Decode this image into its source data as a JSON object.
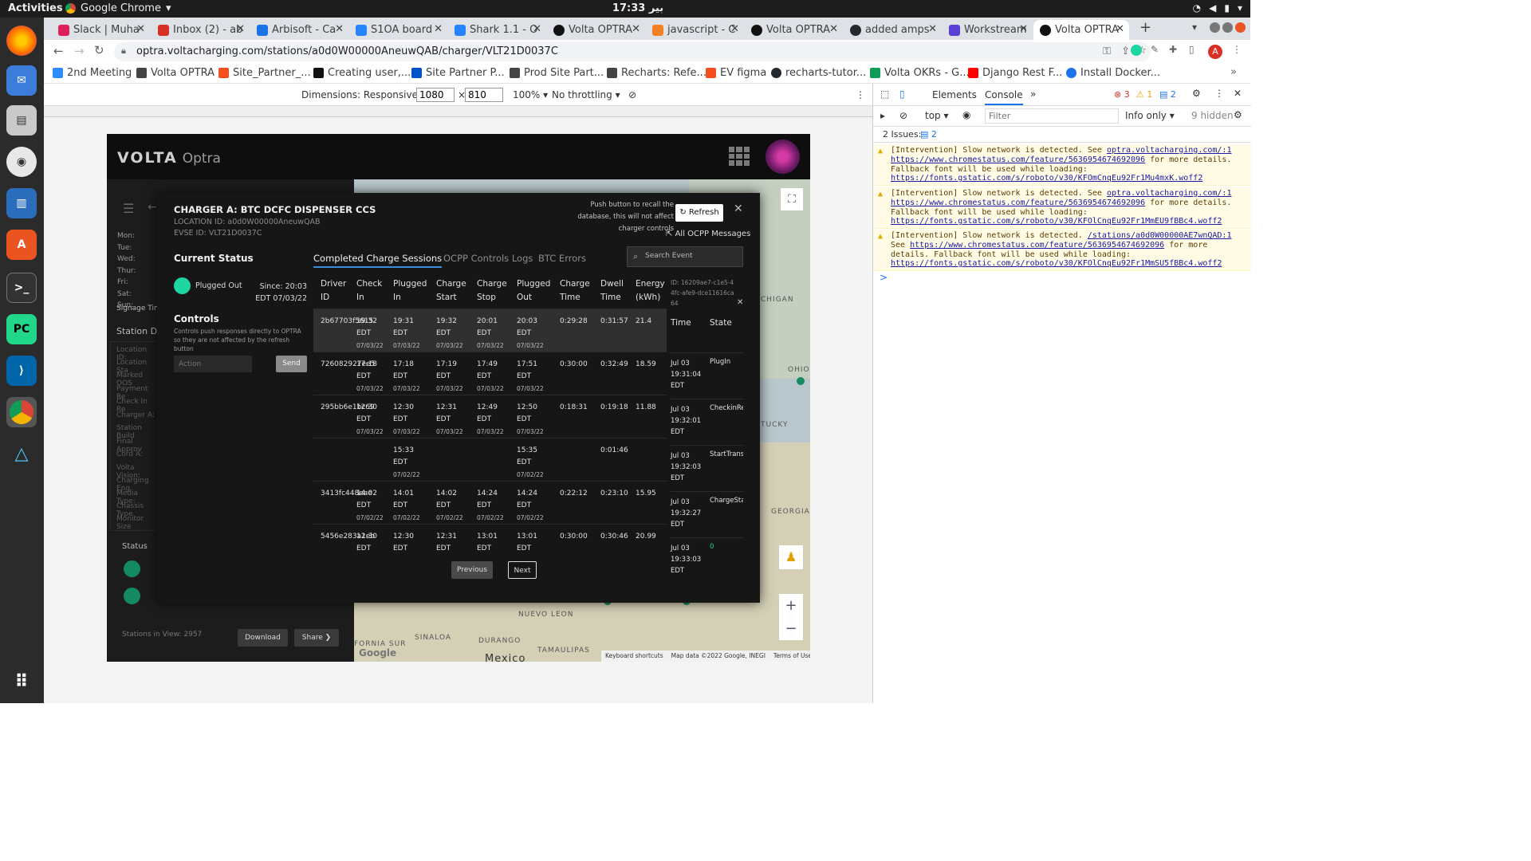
{
  "os": {
    "activities": "Activities",
    "app_name": "Google Chrome",
    "clock": "17:33 بير"
  },
  "tabs": [
    {
      "label": "Slack | Muha",
      "color": "#e01e5a"
    },
    {
      "label": "Inbox (2) - ab",
      "color": "#d93025"
    },
    {
      "label": "Arbisoft - Ca",
      "color": "#1a73e8"
    },
    {
      "label": "S1OA board",
      "color": "#2684ff"
    },
    {
      "label": "Shark 1.1 - O",
      "color": "#2684ff"
    },
    {
      "label": "Volta OPTRA",
      "color": "#111111"
    },
    {
      "label": "javascript - C",
      "color": "#f48024"
    },
    {
      "label": "Volta OPTRA",
      "color": "#111111"
    },
    {
      "label": "added amps",
      "color": "#24292e"
    },
    {
      "label": "Workstream",
      "color": "#5a3fd6"
    },
    {
      "label": "Volta OPTRA",
      "color": "#111111"
    }
  ],
  "url": "optra.voltacharging.com/stations/a0d0W00000AneuwQAB/charger/VLT21D0037C",
  "bookmarks": [
    {
      "label": "2nd Meeting",
      "color": "#2d8cff"
    },
    {
      "label": "Volta OPTRA",
      "color": "#444444"
    },
    {
      "label": "Site_Partner_...",
      "color": "#f24e1e"
    },
    {
      "label": "Creating user,...",
      "color": "#111111"
    },
    {
      "label": "Site Partner P...",
      "color": "#0052cc"
    },
    {
      "label": "Prod Site Part...",
      "color": "#444444"
    },
    {
      "label": "Recharts: Refe...",
      "color": "#444444"
    },
    {
      "label": "EV figma",
      "color": "#f24e1e"
    },
    {
      "label": "recharts-tutor...",
      "color": "#24292e"
    },
    {
      "label": "Volta OKRs - G...",
      "color": "#0f9d58"
    },
    {
      "label": "Django Rest F...",
      "color": "#ff0000"
    },
    {
      "label": "Install Docker...",
      "color": "#1a73e8"
    }
  ],
  "device_toolbar": {
    "dimensions": "Dimensions: Responsive",
    "width": "1080",
    "height": "810",
    "zoom": "100%",
    "throttling": "No throttling"
  },
  "app": {
    "logo": "VOLTA",
    "logo_sub": "Optra",
    "side_days": [
      "Mon:",
      "Tue:",
      "Wed:",
      "Thur:",
      "Fri:",
      "Sat:",
      "Sun:"
    ],
    "side_signage": "Signage Tim",
    "side_station": "Station Det",
    "side_fields": [
      "Location ID:",
      "Location Sta",
      "Marked OOS",
      "Payment Re",
      "Check In Re",
      "Charger A:",
      "Station Build",
      "Final Approv",
      "Cord A:",
      "Volta Vision:",
      "Charging Eng",
      "Media Type:",
      "Chassis Type",
      "Monitor Size"
    ],
    "side_status": "Status",
    "stations_in_view": "Stations in View: 2957",
    "download": "Download",
    "share": "Share",
    "map_labels": [
      "CHIGAN",
      "OHIO",
      "TUCKY",
      "GEORGIA",
      "NUEVO LEON",
      "SINALOA",
      "DURANGO",
      "TAMAULIPAS",
      "FORNIA SUR",
      "Mexico"
    ],
    "map_footer": [
      "Keyboard shortcuts",
      "Map data ©2022 Google, INEGI",
      "Terms of Use"
    ],
    "google": "Google"
  },
  "modal": {
    "title": "CHARGER A: BTC DCFC DISPENSER CCS",
    "location_id": "LOCATION ID: a0d0W00000AneuwQAB",
    "evse_id": "EVSE ID: VLT21D0037C",
    "hint": "Push button to recall the database, this will not affect charger controls",
    "refresh": "Refresh",
    "all_ocpp": "All OCPP Messages",
    "current_status": "Current Status",
    "status": "Plugged Out",
    "since": "Since: 20:03  EDT 07/03/22",
    "controls": "Controls",
    "controls_sub": "Controls push responses directly to OPTRA so they are not affected by the refresh button",
    "action_placeholder": "Action",
    "send": "Send",
    "tabs": [
      "Completed Charge Sessions",
      "OCPP Controls Logs",
      "BTC Errors"
    ],
    "search_placeholder": "Search Event",
    "previous": "Previous",
    "next": "Next",
    "columns": [
      "Driver ID",
      "Check In",
      "Plugged In",
      "Charge Start",
      "Charge Stop",
      "Plugged Out",
      "Charge Time",
      "Dwell Time",
      "Energy (kWh)"
    ],
    "sessions": [
      {
        "driver": "2b67703f5615",
        "check_in": "19:32",
        "check_in_d": "07/03/22",
        "plug_in": "19:31",
        "plug_in_d": "07/03/22",
        "start": "19:32",
        "start_d": "07/03/22",
        "stop": "20:01",
        "stop_d": "07/03/22",
        "plug_out": "20:03",
        "plug_out_d": "07/03/22",
        "charge_time": "0:29:28",
        "dwell": "0:31:57",
        "energy": "21.4"
      },
      {
        "driver": "726082927ee5",
        "check_in": "17:18",
        "check_in_d": "07/03/22",
        "plug_in": "17:18",
        "plug_in_d": "07/03/22",
        "start": "17:19",
        "start_d": "07/03/22",
        "stop": "17:49",
        "stop_d": "07/03/22",
        "plug_out": "17:51",
        "plug_out_d": "07/03/22",
        "charge_time": "0:30:00",
        "dwell": "0:32:49",
        "energy": "18.59"
      },
      {
        "driver": "295bb6e1bc69",
        "check_in": "12:30",
        "check_in_d": "07/03/22",
        "plug_in": "12:30",
        "plug_in_d": "07/03/22",
        "start": "12:31",
        "start_d": "07/03/22",
        "stop": "12:49",
        "stop_d": "07/03/22",
        "plug_out": "12:50",
        "plug_out_d": "07/03/22",
        "charge_time": "0:18:31",
        "dwell": "0:19:18",
        "energy": "11.88"
      },
      {
        "driver": "",
        "check_in": "",
        "check_in_d": "",
        "plug_in": "15:33",
        "plug_in_d": "07/02/22",
        "start": "",
        "start_d": "",
        "stop": "",
        "stop_d": "",
        "plug_out": "15:35",
        "plug_out_d": "07/02/22",
        "charge_time": "",
        "dwell": "0:01:46",
        "energy": ""
      },
      {
        "driver": "3413fc448eae",
        "check_in": "14:02",
        "check_in_d": "07/02/22",
        "plug_in": "14:01",
        "plug_in_d": "07/02/22",
        "start": "14:02",
        "start_d": "07/02/22",
        "stop": "14:24",
        "stop_d": "07/02/22",
        "plug_out": "14:24",
        "plug_out_d": "07/02/22",
        "charge_time": "0:22:12",
        "dwell": "0:23:10",
        "energy": "15.95"
      },
      {
        "driver": "5456e283a1eb",
        "check_in": "12:30",
        "check_in_d": "",
        "plug_in": "12:30",
        "plug_in_d": "",
        "start": "12:31",
        "start_d": "",
        "stop": "13:01",
        "stop_d": "",
        "plug_out": "13:01",
        "plug_out_d": "",
        "charge_time": "0:30:00",
        "dwell": "0:30:46",
        "energy": "20.99"
      }
    ],
    "edt": "EDT",
    "event_id": "ID: 16209ae7-c1e5-44fc-afe9-dce11616ca64",
    "event_columns": [
      "Time",
      "State"
    ],
    "events": [
      {
        "date": "Jul 03",
        "time": "19:31:04",
        "tz": "EDT",
        "state": "PlugIn"
      },
      {
        "date": "Jul 03",
        "time": "19:32:01",
        "tz": "EDT",
        "state": "CheckinRe"
      },
      {
        "date": "Jul 03",
        "time": "19:32:03",
        "tz": "EDT",
        "state": "StartTrans"
      },
      {
        "date": "Jul 03",
        "time": "19:32:27",
        "tz": "EDT",
        "state": "ChargeSta"
      },
      {
        "date": "Jul 03",
        "time": "19:33:03",
        "tz": "EDT",
        "state": "0"
      }
    ]
  },
  "devtools": {
    "tabs": [
      "Elements",
      "Console"
    ],
    "errors": "3",
    "warnings": "1",
    "issues_count": "2",
    "context": "top",
    "filter_placeholder": "Filter",
    "levels": "Info only",
    "hidden": "9 hidden",
    "issues": "2 Issues:",
    "logs": [
      {
        "prefix": "[Intervention] Slow network is detected. See ",
        "link1": "optra.voltacharging.com/:1",
        "link2": "https://www.chromestatus.com/feature/5636954674692096",
        "mid": " for more details. Fallback font will be used while loading: ",
        "link3": "https://fonts.gstatic.com/s/roboto/v30/KFOmCnqEu92Fr1Mu4mxK.woff2"
      },
      {
        "prefix": "[Intervention] Slow network is detected. See ",
        "link1": "optra.voltacharging.com/:1",
        "link2": "https://www.chromestatus.com/feature/5636954674692096",
        "mid": " for more details. Fallback font will be used while loading: ",
        "link3": "https://fonts.gstatic.com/s/roboto/v30/KFOlCnqEu92Fr1MmEU9fBBc4.woff2"
      },
      {
        "prefix": "[Intervention] Slow network is detected. ",
        "link1": "/stations/a0d0W00000AE7wnQAD:1",
        "link2": "https://www.chromestatus.com/feature/5636954674692096",
        "mid": " for more details. Fallback font will be used while loading: ",
        "link3": "https://fonts.gstatic.com/s/roboto/v30/KFOlCnqEu92Fr1MmSU5fBBc4.woff2"
      }
    ],
    "prompt": ">"
  }
}
